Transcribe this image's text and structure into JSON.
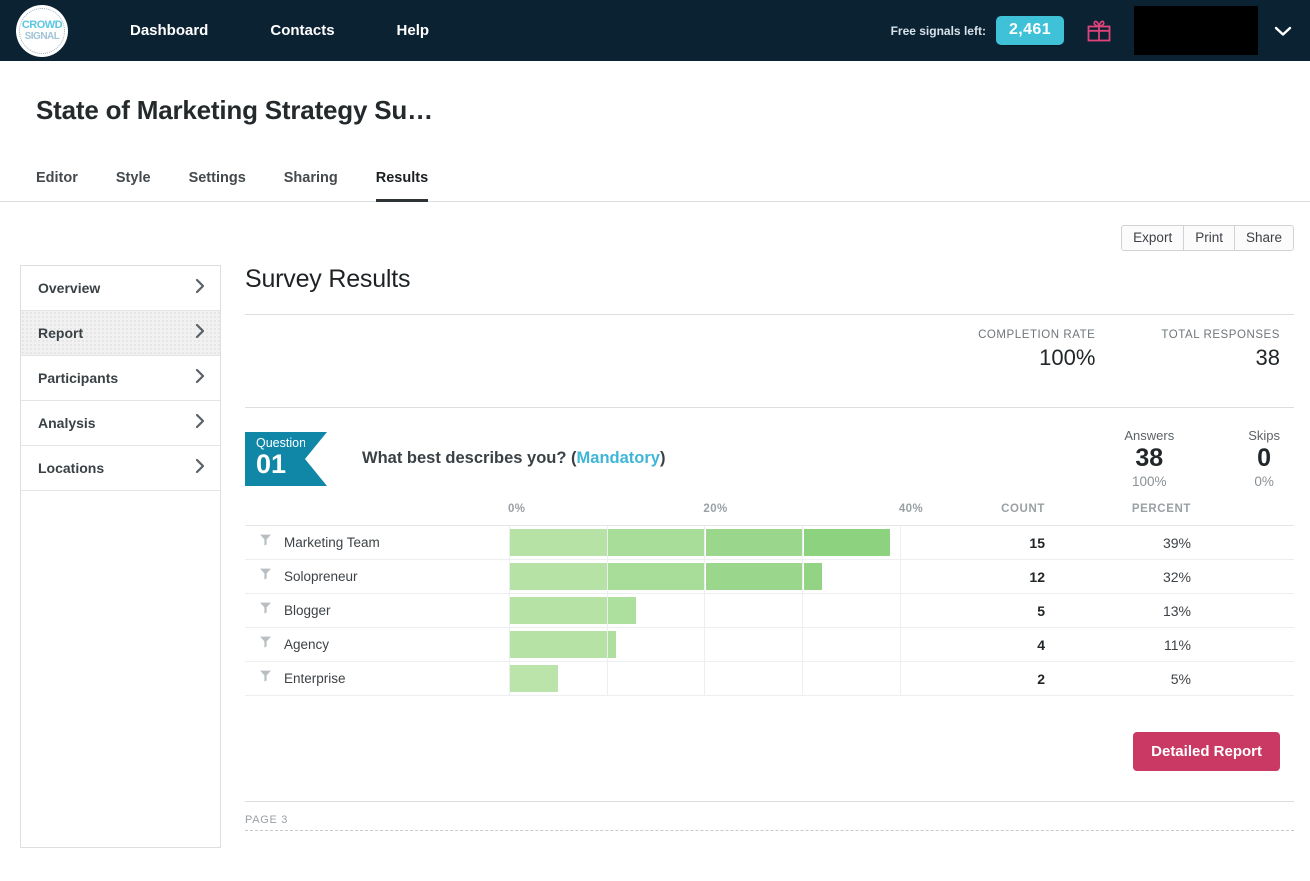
{
  "topnav": {
    "logo_line1": "CROWD",
    "logo_line2": "SIGNAL",
    "links": [
      {
        "label": "Dashboard"
      },
      {
        "label": "Contacts"
      },
      {
        "label": "Help"
      }
    ],
    "signals_label": "Free signals left:",
    "signals_value": "2,461",
    "gift_icon": "gift-icon",
    "chevron_icon": "chevron-down-icon",
    "badge_color": "#3fc1d8",
    "bar_color": "#0b2233"
  },
  "header": {
    "title": "State of Marketing Strategy Su…",
    "tabs": [
      {
        "label": "Editor",
        "active": false
      },
      {
        "label": "Style",
        "active": false
      },
      {
        "label": "Settings",
        "active": false
      },
      {
        "label": "Sharing",
        "active": false
      },
      {
        "label": "Results",
        "active": true
      }
    ]
  },
  "toolbar": {
    "export_label": "Export",
    "print_label": "Print",
    "share_label": "Share"
  },
  "sidebar": {
    "items": [
      {
        "label": "Overview",
        "active": false
      },
      {
        "label": "Report",
        "active": true
      },
      {
        "label": "Participants",
        "active": false
      },
      {
        "label": "Analysis",
        "active": false
      },
      {
        "label": "Locations",
        "active": false
      }
    ]
  },
  "main": {
    "section_title": "Survey Results",
    "stats": [
      {
        "key": "COMPLETION RATE",
        "value": "100%"
      },
      {
        "key": "TOTAL RESPONSES",
        "value": "38"
      }
    ],
    "question": {
      "badge_word": "Question",
      "badge_number": "01",
      "text_before": "What best describes you? (",
      "text_mandatory": "Mandatory",
      "text_after": ")",
      "badge_color": "#1187a8",
      "mandatory_color": "#3fb6d8",
      "answers_key": "Answers",
      "answers_value": "38",
      "answers_pct": "100%",
      "skips_key": "Skips",
      "skips_value": "0",
      "skips_pct": "0%"
    },
    "detailed_report_label": "Detailed Report",
    "detailed_report_color": "#c93963",
    "page_footer": "PAGE 3"
  },
  "chart_data": {
    "type": "bar",
    "title": "What best describes you? (Mandatory)",
    "orientation": "horizontal",
    "categories": [
      "Marketing Team",
      "Solopreneur",
      "Blogger",
      "Agency",
      "Enterprise"
    ],
    "values": [
      39,
      32,
      13,
      11,
      5
    ],
    "counts": [
      15,
      12,
      5,
      4,
      2
    ],
    "percents": [
      "39%",
      "32%",
      "13%",
      "11%",
      "5%"
    ],
    "count_header": "COUNT",
    "percent_header": "PERCENT",
    "xlabel": "",
    "ylabel": "",
    "xlim": [
      0,
      40
    ],
    "xticks": [
      0,
      20,
      40
    ],
    "xtick_labels": [
      "0%",
      "20%",
      "40%"
    ],
    "gridline_step": 10,
    "grid": true,
    "legend": false,
    "bar_color_start": "#bde5ad",
    "bar_color_end": "#85cf78",
    "row_filter_icon": "filter-icon",
    "total_responses": 38
  }
}
